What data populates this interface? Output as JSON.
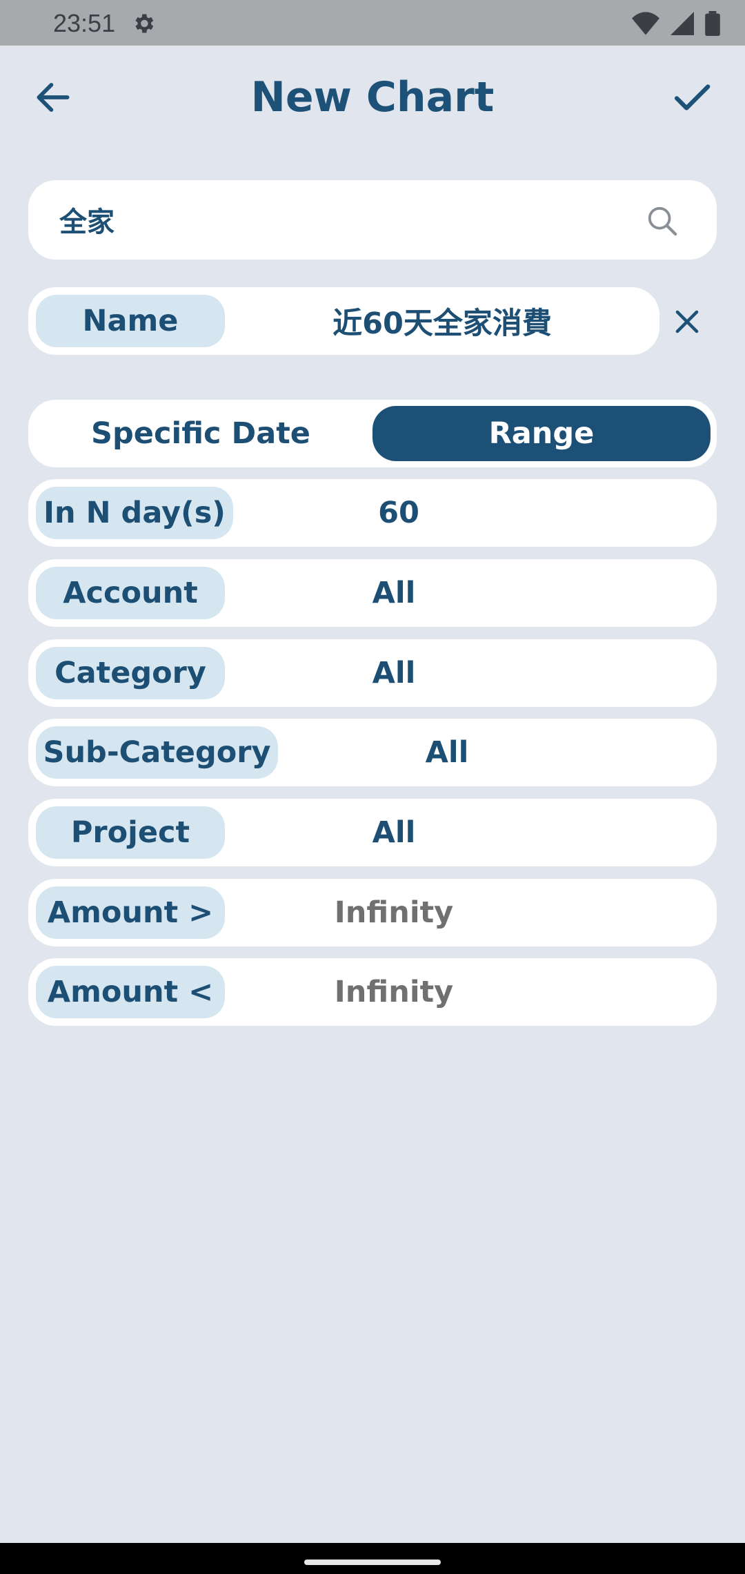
{
  "status_bar": {
    "time": "23:51",
    "icons": [
      "gear-icon",
      "wifi-icon",
      "signal-icon",
      "battery-icon"
    ]
  },
  "app_bar": {
    "title": "New Chart",
    "back_icon": "arrow-left-icon",
    "confirm_icon": "check-icon"
  },
  "search": {
    "value": "全家",
    "icon": "search-icon"
  },
  "name_field": {
    "label": "Name",
    "value": "近60天全家消費",
    "clear_icon": "close-icon"
  },
  "date_mode": {
    "options": [
      "Specific Date",
      "Range"
    ],
    "selected": "Range"
  },
  "fields": [
    {
      "label": "In N day(s)",
      "value": "60"
    },
    {
      "label": "Account",
      "value": "All"
    },
    {
      "label": "Category",
      "value": "All"
    },
    {
      "label": "Sub-Category",
      "value": "All"
    },
    {
      "label": "Project",
      "value": "All"
    },
    {
      "label": "Amount >",
      "value": "Infinity"
    },
    {
      "label": "Amount <",
      "value": "Infinity"
    }
  ],
  "colors": {
    "background": "#e1e6ee",
    "primary": "#1c5077",
    "pill": "#d6e6f0",
    "muted_text": "#707070"
  }
}
